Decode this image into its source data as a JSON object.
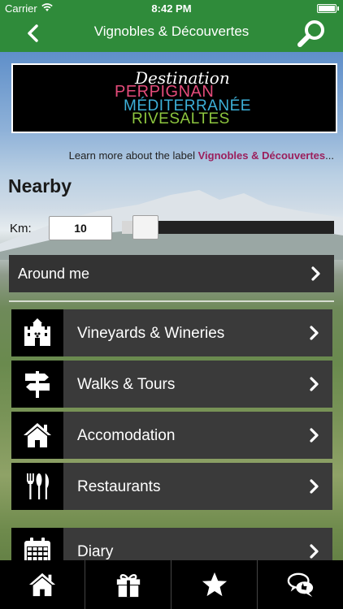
{
  "status_bar": {
    "carrier": "Carrier",
    "time": "8:42 PM"
  },
  "nav": {
    "title": "Vignobles & Découvertes",
    "back_icon": "chevron-left-icon",
    "search_icon": "search-icon"
  },
  "banner": {
    "line1": "Destination",
    "line2": "PERPIGNAN",
    "line3": "MÉDITERRANÉE",
    "line4": "RIVESALTES"
  },
  "learn_more": {
    "prefix": "Learn more about the label ",
    "label": "Vignobles & Découvertes",
    "suffix": "..."
  },
  "nearby": {
    "title": "Nearby",
    "km_label": "Km:",
    "km_value": "10",
    "slider_fraction": 0.05
  },
  "around_me": {
    "label": "Around me"
  },
  "menu": [
    {
      "label": "Vineyards & Wineries",
      "icon": "castle-icon"
    },
    {
      "label": "Walks & Tours",
      "icon": "signpost-icon"
    },
    {
      "label": "Accomodation",
      "icon": "house-icon"
    },
    {
      "label": "Restaurants",
      "icon": "cutlery-icon"
    },
    {
      "label": "Diary",
      "icon": "calendar-icon"
    }
  ],
  "tabbar": [
    {
      "icon": "home-icon"
    },
    {
      "icon": "gift-icon"
    },
    {
      "icon": "star-icon"
    },
    {
      "icon": "chat-icon"
    }
  ],
  "colors": {
    "brand_green": "#2f8b3a",
    "label_accent": "#9b1f5c"
  }
}
